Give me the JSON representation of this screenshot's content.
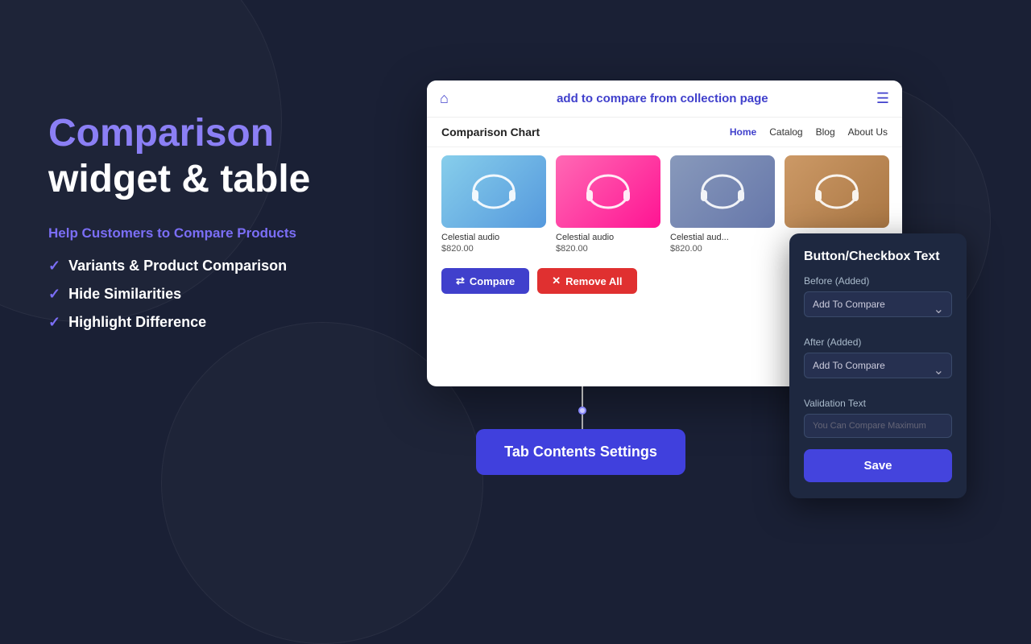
{
  "background": {
    "color": "#1a2035"
  },
  "left_panel": {
    "title_line1": "Comparison",
    "title_line2": "widget & table",
    "subtitle": "Help Customers to Compare Products",
    "features": [
      "Variants & Product Comparison",
      "Hide Similarities",
      "Highlight Difference"
    ]
  },
  "browser": {
    "title": "add to compare from collection page",
    "nav": {
      "brand": "Comparison Chart",
      "links": [
        "Home",
        "Catalog",
        "Blog",
        "About Us"
      ],
      "active_link": "Home"
    },
    "products": [
      {
        "name": "Celestial audio",
        "price": "$820.00",
        "color": "blue"
      },
      {
        "name": "Celestial audio",
        "price": "$820.00",
        "color": "pink"
      },
      {
        "name": "Celestial aud...",
        "price": "$820.00",
        "color": "gray"
      },
      {
        "name": "",
        "price": "",
        "color": "brown"
      }
    ],
    "buttons": {
      "compare": "Compare",
      "remove_all": "Remove All"
    }
  },
  "connector": {},
  "tab_settings_button": {
    "label": "Tab Contents Settings"
  },
  "popup": {
    "title": "Button/Checkbox Text",
    "before_label": "Before (Added)",
    "before_value": "Add To Compare",
    "before_placeholder": "Add To Compare",
    "after_label": "After (Added)",
    "after_value": "Add To Compare",
    "after_placeholder": "Add To Compare",
    "validation_label": "Validation Text",
    "validation_placeholder": "You Can Compare Maximum",
    "save_button": "Save"
  }
}
